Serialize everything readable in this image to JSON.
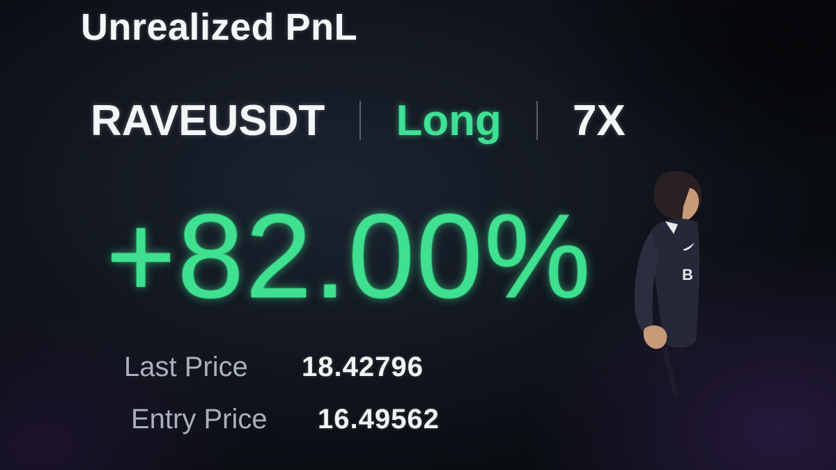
{
  "card": {
    "title": "Unrealized PnL",
    "pair": "RAVEUSDT",
    "side": "Long",
    "leverage": "7X",
    "pnl_percent": "+82.00%",
    "last_price_label": "Last Price",
    "last_price_value": "18.42796",
    "entry_price_label": "Entry Price",
    "entry_price_value": "16.49562"
  },
  "mascot": {
    "icon": "character-figure-icon",
    "jersey_letter": "B"
  },
  "colors": {
    "background": "#121720",
    "profit_green": "#3fe08f",
    "primary_text": "#f4f6f8",
    "secondary_text": "#a9b1bc"
  }
}
